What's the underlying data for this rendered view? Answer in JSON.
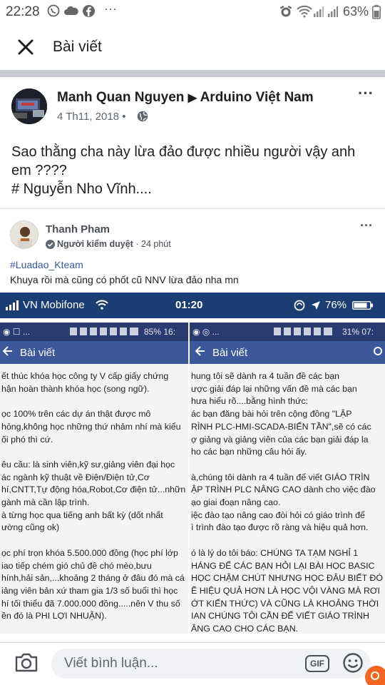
{
  "status_bar": {
    "time": "22:28",
    "battery": "63%",
    "dots": "···"
  },
  "header": {
    "title": "Bài viết"
  },
  "post": {
    "author": "Manh Quan Nguyen",
    "arrow": "▶",
    "group": "Arduino Việt Nam",
    "date": "4 Th11, 2018",
    "separator": "•",
    "text_line1": "Sao thằng cha này lừa đảo được nhiều người vậy anh",
    "text_line2": "em ????",
    "text_line3": "# Nguyễn Nho Vĩnh....",
    "more": "···"
  },
  "shared": {
    "author": "Thanh Pham",
    "badge": "Người kiểm duyệt",
    "separator": "·",
    "time": "24 phút",
    "hashtag": "#Luadao_Kteam",
    "text": "Khuya rồi mà cũng có phốt cũ NNV lừa đảo nha mn",
    "more": "···",
    "phone_bar": {
      "carrier": "VN Mobifone",
      "time": "01:20",
      "battery": "76%"
    },
    "left_screen": {
      "status_left": "◉ ☐ ...",
      "status_right": "85%  16:",
      "title": "Bài viết",
      "lines": [
        "ết thúc khóa học công ty V cấp giấy chứng",
        "hận hoàn thành khóa học (song ngữ).",
        "",
        "ọc 100% trên các dự án thật được mô",
        "hỏng,không học những thứ nhảm nhí mà kiểu",
        "ối phó thì cứ.",
        "",
        "êu cầu: là sinh viên,kỹ sư,giảng viên đại học",
        "ác ngành kỹ thuật về Điện/Điện tử,Cơ",
        "hí,CNTT,Tự động hóa,Robot,Cơ điện tử...nhữn",
        "gành mà cần lập trình.",
        "à từng học qua tiếng anh bất kỳ (dốt nhất",
        "ường cũng ok)",
        "",
        "ọc phí trọn khóa 5.500.000 đồng (học phí lớp",
        "iao tiếp chém gió chủ đề chó mèo,bưu",
        "hính,hải sản,...khoảng 2 tháng ở đâu đó mà cá",
        "iảng viên bản xứ tham gia 1/3 số buổi thì học",
        "hí tối thiểu đã 7.000.000 đồng.....nên V thu số",
        "ền đó là PHI LỢI NHUẬN)."
      ]
    },
    "right_screen": {
      "status_left": "◉ ◎ ...",
      "status_right": "31%  07:",
      "title": "Bài viết",
      "lines": [
        "hung tôi sẽ dành ra 4 tuần đề các bạn",
        "ược giải đáp lại những vấn đề mà các bạn",
        "hưa hiểu rõ....bằng hình thức:",
        "ác bạn đăng bài hỏi trên cộng đồng \"LẬP",
        "RÌNH PLC-HMI-SCADA-BIẾN TẦN\",sẽ có các",
        "ợ giảng và giảng viên của các bạn giải đáp la",
        "ho các bạn những câu hỏi ấy.",
        "",
        "à,chúng tôi dành ra 4 tuần để viết GIÁO TRÌN",
        "ẬP TRÌNH PLC NÂNG CAO dành cho việc đào",
        "ạo giai đoạn nâng cao.",
        "iệc đào tạo nâng cao đòi hỏi có giáo trình để",
        "ì trình đào tạo được rõ ràng và hiệu quả hơn.",
        "",
        "ó là lý do tôi báo: CHÚNG TA TẠM NGHỈ 1",
        "HÁNG ĐỂ CÁC BẠN HỎI LẠI BÀI HỌC BASIC",
        "HỌC CHẬM CHÚT NHƯNG HỌC ĐÂU BIẾT ĐÓ",
        "Ẽ HIỆU QUẢ HƠN LÀ HỌC VỘI VÀNG MÀ RƠI",
        "ỚT KIẾN THỨC) VÀ CŨNG LÀ KHOẢNG THỜI",
        "IAN CHÚNG TÔI CẦN ĐỂ VIẾT GIÁO TRÌNH",
        "ÂNG CAO CHO CÁC BẠN."
      ]
    }
  },
  "comment_bar": {
    "placeholder": "Viết bình luận...",
    "gif": "GIF"
  },
  "colors": {
    "fb_blue": "#3b5998",
    "link_blue": "#385898",
    "phone_bar": "#1a3e73"
  }
}
